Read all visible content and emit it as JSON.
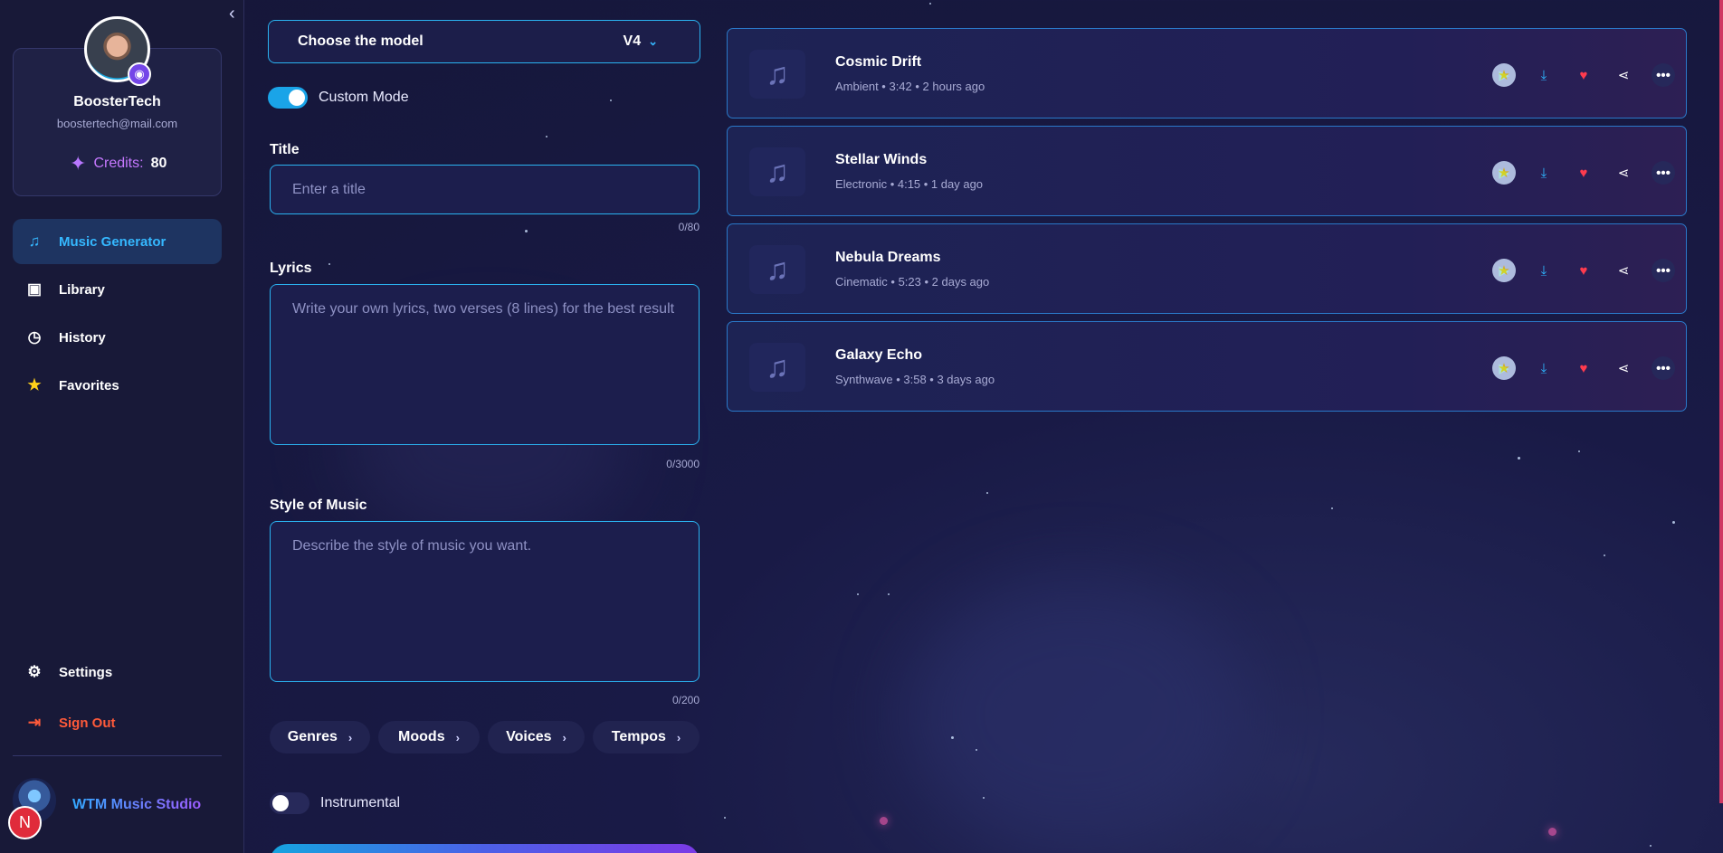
{
  "sidebar": {
    "profile": {
      "name": "BoosterTech",
      "email": "boostertech@mail.com",
      "credits_label": "Credits:",
      "credits_value": "80"
    },
    "nav": [
      {
        "label": "Music Generator",
        "icon": "music-wave-icon"
      },
      {
        "label": "Library",
        "icon": "library-icon"
      },
      {
        "label": "History",
        "icon": "history-icon"
      },
      {
        "label": "Favorites",
        "icon": "star-icon"
      }
    ],
    "settings_label": "Settings",
    "signout_label": "Sign Out",
    "brand_name": "WTM Music Studio",
    "brand_badge": "N"
  },
  "form": {
    "model_label": "Choose the model",
    "model_value": "V4",
    "custom_mode_label": "Custom Mode",
    "custom_mode_on": true,
    "title_label": "Title",
    "title_placeholder": "Enter a title",
    "title_counter": "0/80",
    "lyrics_label": "Lyrics",
    "lyrics_placeholder": "Write your own lyrics, two verses (8 lines) for the best result",
    "lyrics_counter": "0/3000",
    "style_label": "Style of Music",
    "style_placeholder": "Describe the style of music you want.",
    "style_counter": "0/200",
    "chips": [
      "Genres",
      "Moods",
      "Voices",
      "Tempos"
    ],
    "instrumental_label": "Instrumental",
    "instrumental_on": false
  },
  "tracks": [
    {
      "name": "Cosmic Drift",
      "meta": "Ambient • 3:42 • 2 hours ago"
    },
    {
      "name": "Stellar Winds",
      "meta": "Electronic • 4:15 • 1 day ago"
    },
    {
      "name": "Nebula Dreams",
      "meta": "Cinematic • 5:23 • 2 days ago"
    },
    {
      "name": "Galaxy Echo",
      "meta": "Synthwave • 3:58 • 3 days ago"
    }
  ],
  "colors": {
    "accent": "#2ab2f0",
    "active_nav": "#35b8ff",
    "signout": "#ff5a3a",
    "credits": "#c678ff"
  }
}
